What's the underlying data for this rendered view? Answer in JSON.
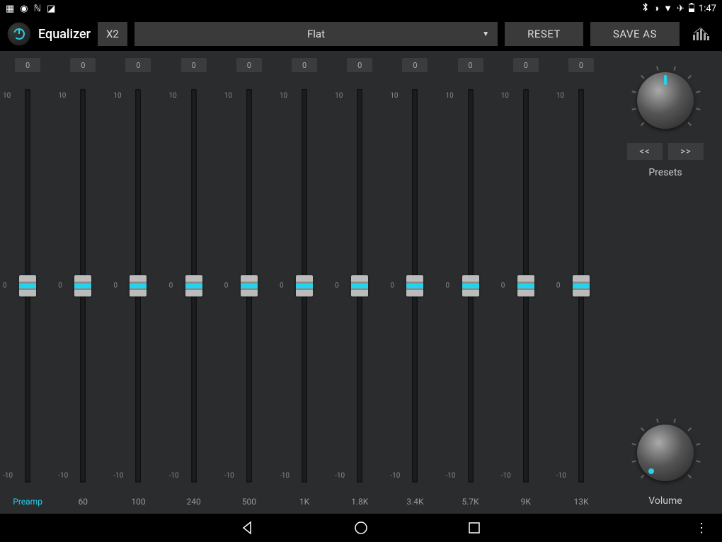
{
  "statusbar": {
    "time": "1:47"
  },
  "toolbar": {
    "title": "Equalizer",
    "x2_label": "X2",
    "preset_selected": "Flat",
    "reset_label": "RESET",
    "saveas_label": "SAVE AS"
  },
  "eq": {
    "scale_top": "10",
    "scale_mid": "0",
    "scale_bot": "-10",
    "bands": [
      {
        "value": "0",
        "label": "Preamp",
        "is_preamp": true
      },
      {
        "value": "0",
        "label": "60"
      },
      {
        "value": "0",
        "label": "100"
      },
      {
        "value": "0",
        "label": "240"
      },
      {
        "value": "0",
        "label": "500"
      },
      {
        "value": "0",
        "label": "1K"
      },
      {
        "value": "0",
        "label": "1.8K"
      },
      {
        "value": "0",
        "label": "3.4K"
      },
      {
        "value": "0",
        "label": "5.7K"
      },
      {
        "value": "0",
        "label": "9K"
      },
      {
        "value": "0",
        "label": "13K"
      }
    ]
  },
  "right": {
    "prev_label": "<<",
    "next_label": ">>",
    "presets_label": "Presets",
    "volume_label": "Volume"
  }
}
